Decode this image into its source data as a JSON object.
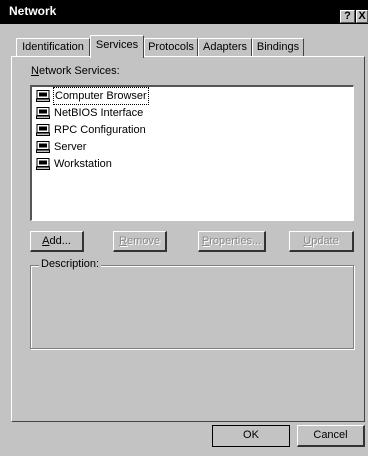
{
  "window": {
    "title": "Network"
  },
  "titlebar": {
    "help_label": "?",
    "close_label": "X"
  },
  "tabs": [
    {
      "label": "Identification",
      "active": false
    },
    {
      "label": "Services",
      "active": true
    },
    {
      "label": "Protocols",
      "active": false
    },
    {
      "label": "Adapters",
      "active": false
    },
    {
      "label": "Bindings",
      "active": false
    }
  ],
  "services": {
    "list_label_mnemonic": "N",
    "list_label_rest": "etwork Services:",
    "items": [
      {
        "label": "Computer Browser",
        "icon": "computer-service-icon",
        "selected": true
      },
      {
        "label": "NetBIOS Interface",
        "icon": "computer-service-icon",
        "selected": false
      },
      {
        "label": "RPC Configuration",
        "icon": "computer-service-icon",
        "selected": false
      },
      {
        "label": "Server",
        "icon": "computer-service-icon",
        "selected": false
      },
      {
        "label": "Workstation",
        "icon": "computer-service-icon",
        "selected": false
      }
    ],
    "buttons": {
      "add_mnemonic": "A",
      "add_rest": "dd...",
      "remove_mnemonic": "R",
      "remove_rest": "emove",
      "properties_mnemonic": "P",
      "properties_rest": "roperties...",
      "update_mnemonic": "U",
      "update_rest": "pdate"
    },
    "description_label": "Description:"
  },
  "dialog": {
    "ok_label": "OK",
    "cancel_label": "Cancel"
  }
}
